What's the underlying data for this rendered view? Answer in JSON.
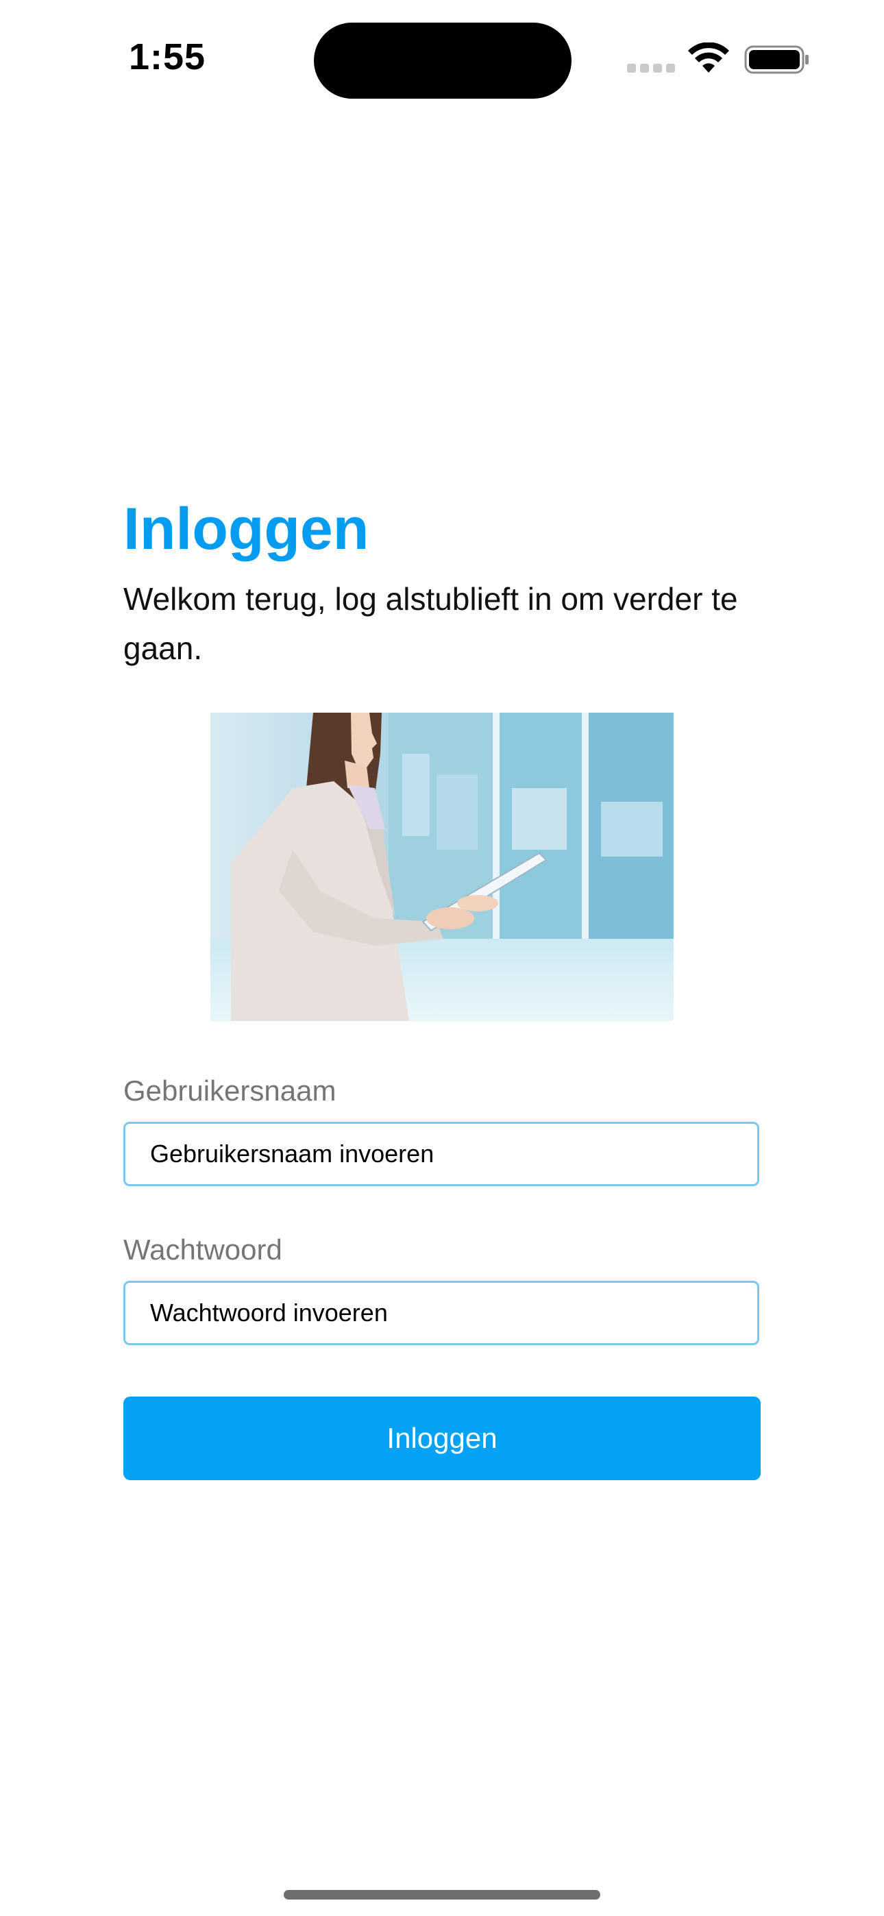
{
  "status_bar": {
    "time": "1:55",
    "icons": [
      "cellular-signal-icon",
      "wifi-icon",
      "battery-icon"
    ]
  },
  "login": {
    "title": "Inloggen",
    "subtitle": "Welkom terug, log alstublieft in om verder te gaan.",
    "image": "businesswoman-with-tablet-photo",
    "username": {
      "label": "Gebruikersnaam",
      "placeholder": "Gebruikersnaam invoeren",
      "value": ""
    },
    "password": {
      "label": "Wachtwoord",
      "placeholder": "Wachtwoord invoeren",
      "value": ""
    },
    "submit_label": "Inloggen"
  },
  "colors": {
    "accent": "#049cf0",
    "button": "#03a2f5",
    "input_border": "#78c8f0",
    "label": "#757575"
  }
}
